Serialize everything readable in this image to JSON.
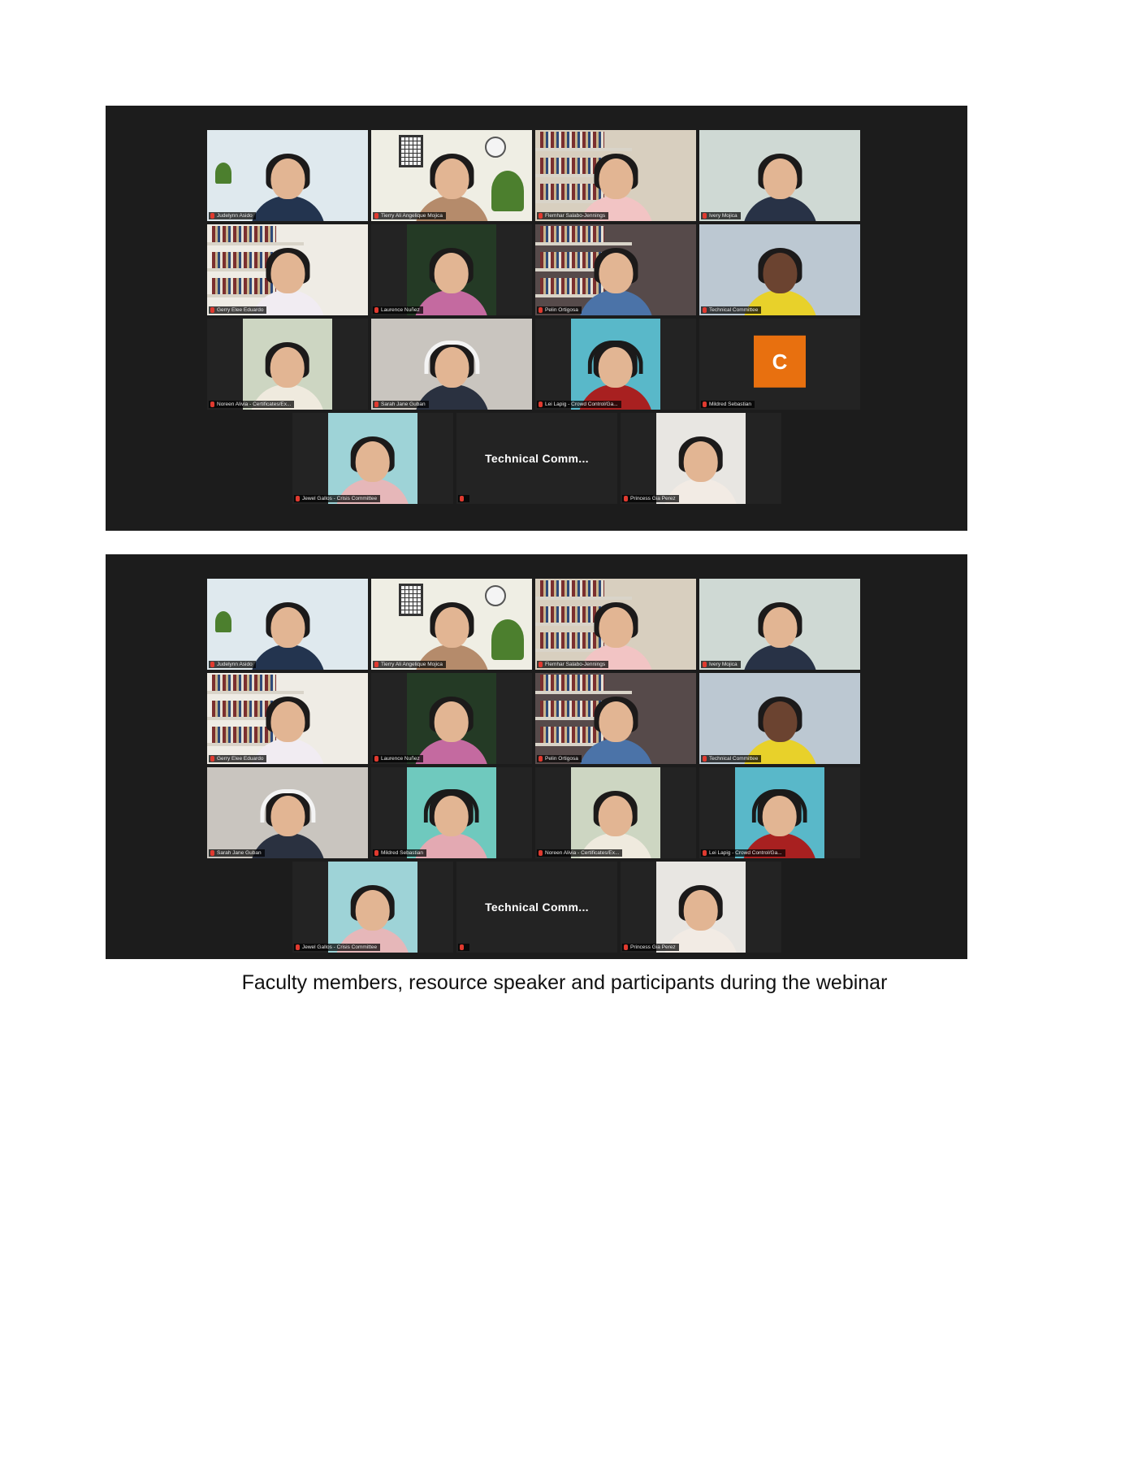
{
  "screenshots": [
    {
      "tiles": [
        {
          "name": "Judelynn Asido"
        },
        {
          "name": "Tierry Ali Angelique Mojica",
          "active": true
        },
        {
          "name": "Flemhar Salabo-Jennings"
        },
        {
          "name": "Ivery Mojica"
        },
        {
          "name": "Gerry Elee Eduardo"
        },
        {
          "name": "Laurence Nuñez"
        },
        {
          "name": "Pelin Ortigosa"
        },
        {
          "name": "Technical Committee"
        },
        {
          "name": "Noreen Alivia - Certificates/Ex..."
        },
        {
          "name": "Sarah Jane Guban"
        },
        {
          "name": "Lei Lapig - Crowd Control/Ga..."
        },
        {
          "name": "Mildred Sebastian",
          "initial": "C"
        },
        {
          "name": "Jewel Gallos - Crisis Committee"
        },
        {
          "name": "",
          "label": "Technical  Comm..."
        },
        {
          "name": "Princess Gia Perez"
        }
      ]
    },
    {
      "tiles": [
        {
          "name": "Judelynn Asido"
        },
        {
          "name": "Tierry Ali Angelique Mojica",
          "active": true
        },
        {
          "name": "Flemhar Salabo-Jennings"
        },
        {
          "name": "Ivery Mojica"
        },
        {
          "name": "Gerry Elee Eduardo"
        },
        {
          "name": "Laurence Nuñez"
        },
        {
          "name": "Pelin Ortigosa"
        },
        {
          "name": "Technical Committee"
        },
        {
          "name": "Sarah Jane Guban"
        },
        {
          "name": "Mildred Sebastian"
        },
        {
          "name": "Noreen Alivia - Certificates/Ex..."
        },
        {
          "name": "Lei Lapig - Crowd Control/Ga..."
        },
        {
          "name": "Jewel Gallos - Crisis Committee"
        },
        {
          "name": "",
          "label": "Technical  Comm..."
        },
        {
          "name": "Princess Gia Perez"
        }
      ]
    }
  ],
  "caption": "Faculty members, resource speaker and participants during the webinar"
}
